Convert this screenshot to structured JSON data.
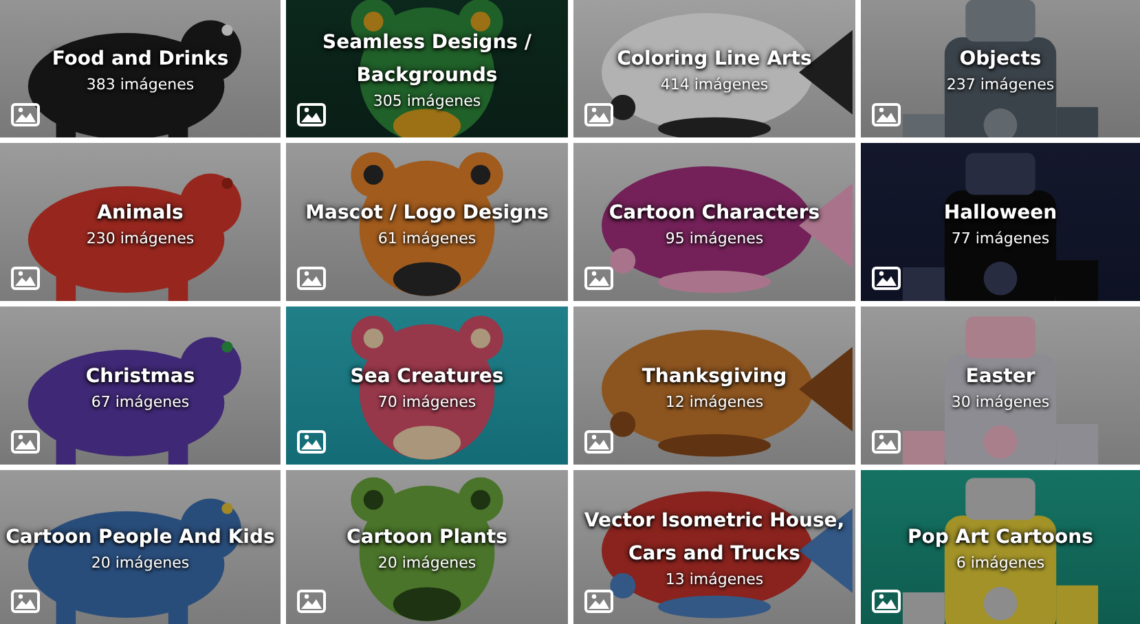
{
  "categories": [
    {
      "title": "Food and Drinks",
      "count": "383 imágenes"
    },
    {
      "title": "Seamless Designs /\nBackgrounds",
      "count": "305 imágenes"
    },
    {
      "title": "Coloring Line Arts",
      "count": "414 imágenes"
    },
    {
      "title": "Objects",
      "count": "237 imágenes"
    },
    {
      "title": "Animals",
      "count": "230 imágenes"
    },
    {
      "title": "Mascot / Logo Designs",
      "count": "61 imágenes"
    },
    {
      "title": "Cartoon Characters",
      "count": "95 imágenes"
    },
    {
      "title": "Halloween",
      "count": "77 imágenes"
    },
    {
      "title": "Christmas",
      "count": "67 imágenes"
    },
    {
      "title": "Sea Creatures",
      "count": "70 imágenes"
    },
    {
      "title": "Thanksgiving",
      "count": "12 imágenes"
    },
    {
      "title": "Easter",
      "count": "30 imágenes"
    },
    {
      "title": "Cartoon People And Kids",
      "count": "20 imágenes"
    },
    {
      "title": "Cartoon Plants",
      "count": "20 imágenes"
    },
    {
      "title": "Vector Isometric House,\nCars and Trucks",
      "count": "13 imágenes"
    },
    {
      "title": "Pop Art Cartoons",
      "count": "6 imágenes"
    }
  ]
}
